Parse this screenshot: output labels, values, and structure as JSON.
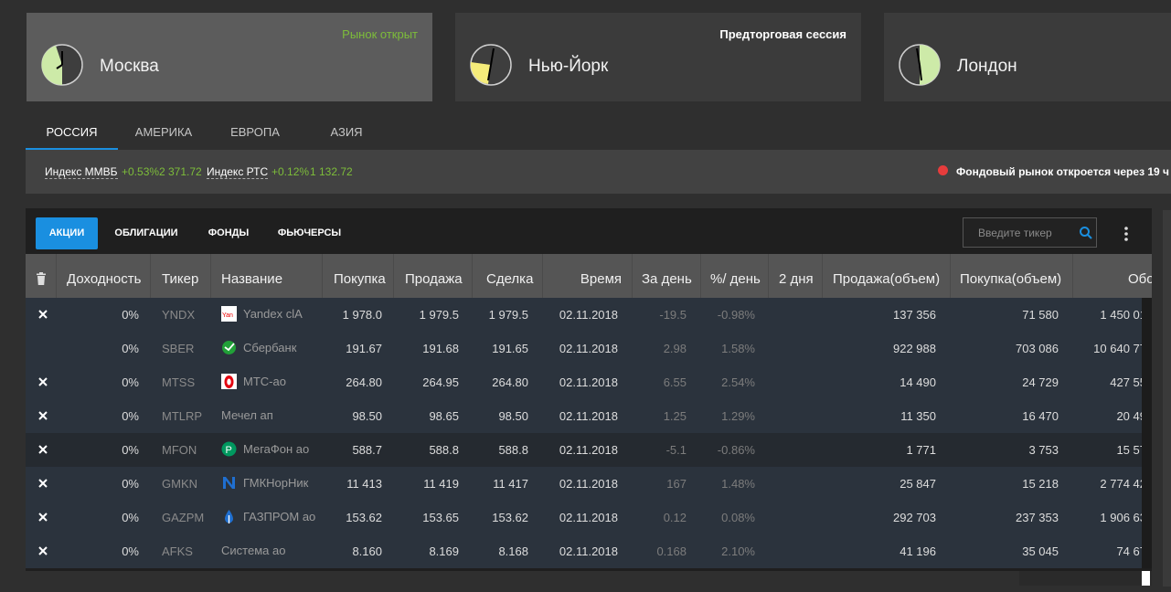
{
  "markets": [
    {
      "city": "Москва",
      "status": "Рынок открыт",
      "status_color": "#7dbd3a",
      "active": true
    },
    {
      "city": "Нью-Йорк",
      "status": "Предторговая сессия",
      "status_color": "#ffffff",
      "active": false
    },
    {
      "city": "Лондон",
      "status": "",
      "status_color": "#ffffff",
      "active": false
    }
  ],
  "region_tabs": [
    "РОССИЯ",
    "АМЕРИКА",
    "ЕВРОПА",
    "АЗИЯ"
  ],
  "indices": [
    {
      "name": "Индекс ММВБ",
      "change": "+0.53%",
      "value": "2 371.72"
    },
    {
      "name": "Индекс РТС",
      "change": "+0.12%",
      "value": "1 132.72"
    }
  ],
  "market_message": "Фондовый рынок откроется через 19 ч",
  "asset_tabs": [
    "АКЦИИ",
    "ОБЛИГАЦИИ",
    "ФОНДЫ",
    "ФЬЮЧЕРСЫ"
  ],
  "search": {
    "placeholder": "Введите тикер"
  },
  "columns": [
    "Доходность",
    "Тикер",
    "Название",
    "Покупка",
    "Продажа",
    "Сделка",
    "Время",
    "За день",
    "%/ день",
    "2 дня",
    "Продажа(объем)",
    "Покупка(объем)",
    "Обо"
  ],
  "rows": [
    {
      "x": true,
      "yield": "0%",
      "ticker": "YNDX",
      "name": "Yandex clA",
      "logo": "yandex-logo",
      "buy": "1 978.0",
      "sell": "1 979.5",
      "deal": "1 979.5",
      "time": "02.11.2018",
      "day": "-19.5",
      "pct": "-0.98%",
      "d2": "",
      "sellvol": "137 356",
      "buyvol": "71 580",
      "turn": "1 450 01"
    },
    {
      "x": false,
      "yield": "0%",
      "ticker": "SBER",
      "name": "Сбербанк",
      "logo": "sberbank-logo",
      "buy": "191.67",
      "sell": "191.68",
      "deal": "191.65",
      "time": "02.11.2018",
      "day": "2.98",
      "pct": "1.58%",
      "d2": "",
      "sellvol": "922 988",
      "buyvol": "703 086",
      "turn": "10 640 77"
    },
    {
      "x": true,
      "yield": "0%",
      "ticker": "MTSS",
      "name": "МТС-ао",
      "logo": "mts-logo",
      "buy": "264.80",
      "sell": "264.95",
      "deal": "264.80",
      "time": "02.11.2018",
      "day": "6.55",
      "pct": "2.54%",
      "d2": "",
      "sellvol": "14 490",
      "buyvol": "24 729",
      "turn": "427 55"
    },
    {
      "x": true,
      "yield": "0%",
      "ticker": "MTLRP",
      "name": "Мечел ап",
      "logo": "",
      "buy": "98.50",
      "sell": "98.65",
      "deal": "98.50",
      "time": "02.11.2018",
      "day": "1.25",
      "pct": "1.29%",
      "d2": "",
      "sellvol": "11 350",
      "buyvol": "16 470",
      "turn": "20 49"
    },
    {
      "x": true,
      "yield": "0%",
      "ticker": "MFON",
      "name": "МегаФон ао",
      "logo": "megafon-logo",
      "buy": "588.7",
      "sell": "588.8",
      "deal": "588.8",
      "time": "02.11.2018",
      "day": "-5.1",
      "pct": "-0.86%",
      "d2": "",
      "sellvol": "1 771",
      "buyvol": "3 753",
      "turn": "15 57"
    },
    {
      "x": true,
      "yield": "0%",
      "ticker": "GMKN",
      "name": "ГМКНорНик",
      "logo": "nornickel-logo",
      "buy": "11 413",
      "sell": "11 419",
      "deal": "11 417",
      "time": "02.11.2018",
      "day": "167",
      "pct": "1.48%",
      "d2": "",
      "sellvol": "25 847",
      "buyvol": "15 218",
      "turn": "2 774 42"
    },
    {
      "x": true,
      "yield": "0%",
      "ticker": "GAZPM",
      "name": "ГАЗПРОМ ао",
      "logo": "gazprom-logo",
      "buy": "153.62",
      "sell": "153.65",
      "deal": "153.62",
      "time": "02.11.2018",
      "day": "0.12",
      "pct": "0.08%",
      "d2": "",
      "sellvol": "292 703",
      "buyvol": "237 353",
      "turn": "1 906 63"
    },
    {
      "x": true,
      "yield": "0%",
      "ticker": "AFKS",
      "name": "Система ао",
      "logo": "",
      "buy": "8.160",
      "sell": "8.169",
      "deal": "8.168",
      "time": "02.11.2018",
      "day": "0.168",
      "pct": "2.10%",
      "d2": "",
      "sellvol": "41 196",
      "buyvol": "35 045",
      "turn": "74 67"
    }
  ]
}
